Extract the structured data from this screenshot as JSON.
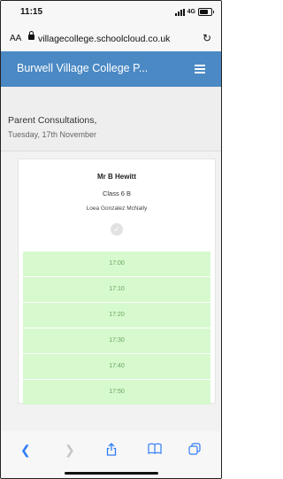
{
  "status_bar": {
    "time": "11:15",
    "network": "4G"
  },
  "browser": {
    "text_size_label": "AA",
    "url": "villagecollege.schoolcloud.co.uk"
  },
  "app": {
    "title": "Burwell Village College P..."
  },
  "page": {
    "title": "Parent Consultations,",
    "date": "Tuesday, 17th November"
  },
  "appointment": {
    "teacher": "Mr B Hewitt",
    "class": "Class 6 B",
    "student": "Loea Gonzalez McNally",
    "slots": [
      "17:00",
      "17:10",
      "17:20",
      "17:30",
      "17:40",
      "17:50"
    ]
  },
  "toolbar": {
    "icons": [
      "back-icon",
      "forward-icon",
      "share-icon",
      "bookmarks-icon",
      "tabs-icon"
    ]
  },
  "colors": {
    "header_blue": "#4a89c4",
    "slot_green": "#d6f9ce",
    "slot_text": "#6aa45f",
    "ios_blue": "#2f7cf6"
  }
}
